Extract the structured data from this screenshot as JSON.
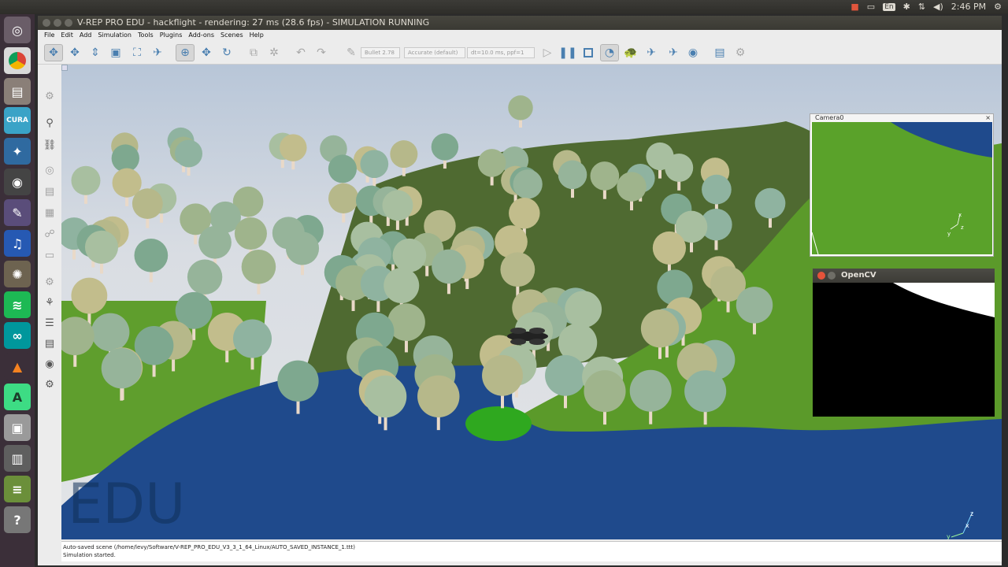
{
  "topbar": {
    "time": "2:46 PM",
    "lang": "En"
  },
  "window": {
    "title": "V-REP PRO EDU - hackflight - rendering: 27 ms (28.6 fps) - SIMULATION RUNNING"
  },
  "menu": [
    "File",
    "Edit",
    "Add",
    "Simulation",
    "Tools",
    "Plugins",
    "Add-ons",
    "Scenes",
    "Help"
  ],
  "toolbar": {
    "engine": "Bullet 2.78",
    "accuracy": "Accurate (default)",
    "timestep": "dt=10.0 ms, ppf=1"
  },
  "viewport": {
    "watermark": "EDU",
    "axis_z": "z",
    "axis_x": "x",
    "axis_y": "y"
  },
  "camera_window": {
    "title": "Camera0",
    "close": "×",
    "axis_x": "x",
    "axis_y": "y",
    "axis_z": "z"
  },
  "opencv_window": {
    "title": "OpenCV"
  },
  "status": {
    "line1": "Auto-saved scene (/home/levy/Software/V-REP_PRO_EDU_V3_3_1_64_Linux/AUTO_SAVED_INSTANCE_1.ttt)",
    "line2": "Simulation started."
  },
  "colors": {
    "water": "#1f4a8c",
    "grass": "#5a9c2a",
    "hill": "#4d6a32",
    "sky": "#c8d2de"
  }
}
